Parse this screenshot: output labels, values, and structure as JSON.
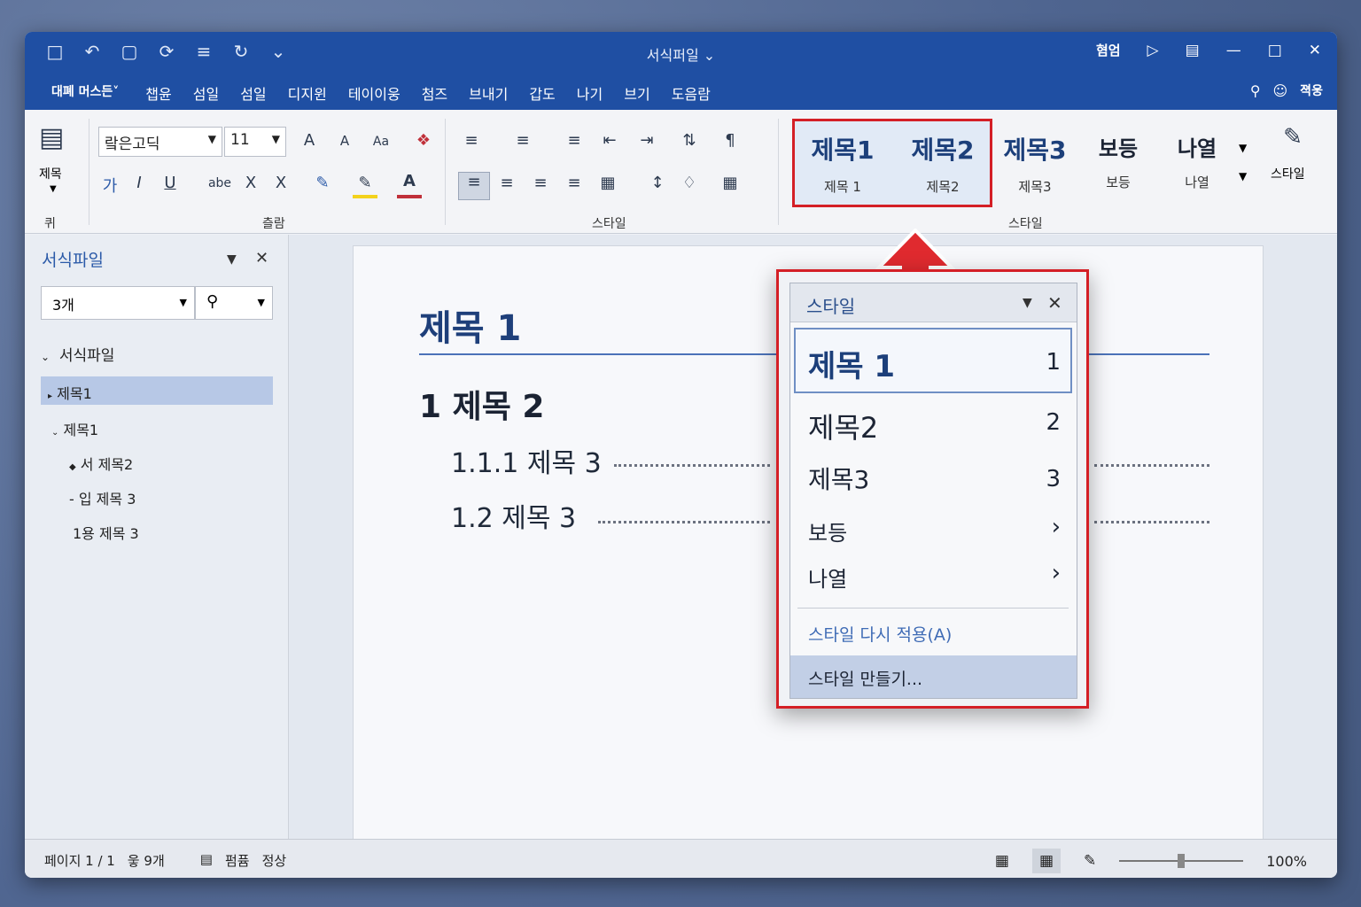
{
  "title_bar": {
    "document_title": "서식퍼일",
    "title_dropdown": "⌄",
    "account_label": "혐엄",
    "qat_icons": [
      "save-icon",
      "undo-icon",
      "clipboard-icon",
      "refresh-icon",
      "list-icon",
      "redo-icon",
      "customize-icon"
    ]
  },
  "menu": {
    "tabs": [
      "대폐 머스든˅",
      "챕윤",
      "섬일",
      "섬일",
      "디지윈",
      "테이이웅",
      "첨즈",
      "브내기",
      "갑도",
      "나기",
      "브기",
      "도음람"
    ],
    "right_label": "젹웅"
  },
  "ribbon": {
    "paste_label": "제목",
    "clipboard_group": "퀴",
    "font_name": "랔은고딕",
    "font_size": "11",
    "font_group": "츨람",
    "paragraph_group": "스타일",
    "styles_group": "스타일",
    "styles_button": "스타일",
    "font_buttons": {
      "grow": "A",
      "shrink": "A",
      "case": "Aa",
      "bold": "가",
      "italic": "I",
      "underline": "U",
      "strike": "abe",
      "subscript": "X",
      "superscript": "X"
    },
    "gallery": [
      {
        "big": "제목1",
        "small": "제목 1"
      },
      {
        "big": "제목2",
        "small": "제목2"
      },
      {
        "big": "제목3",
        "small": "제목3"
      },
      {
        "big": "보등",
        "small": "보등"
      },
      {
        "big": "나열",
        "small": "나열"
      }
    ]
  },
  "nav_pane": {
    "title": "서식파일",
    "search_value": "3개",
    "tree_root": "서식파일",
    "items": [
      "제목1",
      "제목1",
      "서 제목2",
      "입 제목 3",
      "1용 제목 3"
    ]
  },
  "document": {
    "heading1": "제목 1",
    "heading2": "1 제목 2",
    "heading3a": "1.1.1 제목 3",
    "heading3b": "1.2 제목 3"
  },
  "styles_popup": {
    "title": "스타일",
    "rows": [
      {
        "label": "제목 1",
        "key": "1"
      },
      {
        "label": "제목2",
        "key": "2"
      },
      {
        "label": "제목3",
        "key": "3"
      },
      {
        "label": "보등",
        "key": "›"
      },
      {
        "label": "나열",
        "key": "›"
      }
    ],
    "reapply": "스타일 다시 적용(A)",
    "create": "스타일 만들기..."
  },
  "status_bar": {
    "page_info": "페이지 1 / 1",
    "word_count": "웋 9개",
    "mode": "펌퓸",
    "state": "정상",
    "zoom": "100%",
    "zoom_fraction": 0.5
  },
  "colors": {
    "title_bar": "#1f4fa3",
    "highlight": "#d41f26",
    "heading": "#1e3f7a"
  }
}
